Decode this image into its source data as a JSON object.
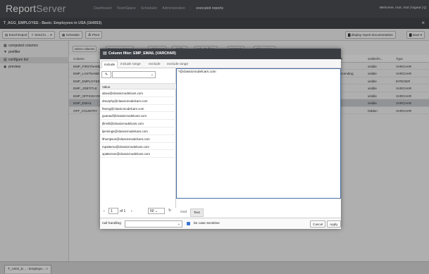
{
  "app": {
    "logo_main": "Report",
    "logo_rest": "Server",
    "nav": [
      "Dashboard",
      "TeamSpace",
      "Scheduler",
      "Administration"
    ],
    "nav_sep": "|",
    "nav_current": "executed reports",
    "user_text": "Welcome, root, root | logout | Q"
  },
  "report": {
    "title": "T_AGG_EMPLOYEE - Basic: Employees in USA (164553)",
    "close_icon": "×"
  },
  "toolbar": {
    "export": "Excel-Export ▾",
    "send_to": "Send to ... ▾",
    "schedule": "Schedule",
    "pivot": "Pivot",
    "display_doc": "display report documentation",
    "save": "save ▾"
  },
  "sidebar": {
    "items": [
      {
        "label": "computed columns",
        "icon": "computed-icon"
      },
      {
        "label": "prefilter",
        "icon": "filter-icon"
      },
      {
        "label": "configure list",
        "icon": "list-icon"
      },
      {
        "label": "preview",
        "icon": "eye-icon"
      }
    ]
  },
  "subtoolbar": {
    "select_columns": "select columns",
    "remove_column": "Remove column ▾",
    "edit_format": "edit format",
    "edit_filter": "edit filter",
    "defaults": "defaults filters",
    "subtotals": "Subtotals",
    "edit_template": "Edit template"
  },
  "grid": {
    "headers": [
      "Column",
      "",
      "Sort",
      "visible/hi...",
      "Type"
    ],
    "rows": [
      {
        "column": "EMP_FIRSTNAME",
        "sort": "",
        "visible": "visible",
        "type": "VARCHAR"
      },
      {
        "column": "EMP_LASTNAME",
        "sort": "descending",
        "visible": "visible",
        "type": "VARCHAR"
      },
      {
        "column": "EMP_EMPLOYEENUMBER",
        "sort": "",
        "visible": "visible",
        "type": "INTEGER"
      },
      {
        "column": "EMP_JOBTITLE",
        "sort": "",
        "visible": "visible",
        "type": "VARCHAR"
      },
      {
        "column": "EMP_OFFICECODE",
        "sort": "",
        "visible": "visible",
        "type": "VARCHAR"
      },
      {
        "column": "EMP_EMAIL",
        "sort": "",
        "visible": "visible",
        "type": "VARCHAR"
      },
      {
        "column": "OFF_COUNTRY",
        "sort": "",
        "visible": "hidden",
        "type": "VARCHAR"
      }
    ]
  },
  "bottom_tab": {
    "label": "T_AGG_E... : Employe...",
    "close": "×"
  },
  "dialog": {
    "title": "Column filter: EMP_EMAIL (VARCHAR)",
    "tabs": [
      "include",
      "include range",
      "exclude",
      "exclude range"
    ],
    "active_tab": "include",
    "value_header": "Value",
    "values": [
      "abow@classicmodelcars.com",
      "dmurphy@classicmodelcars.com",
      "ftseng@classicmodelcars.com",
      "gvanauf@classicmodelcars.com",
      "jfirrelli@classicmodelcars.com",
      "ljennings@classicmodelcars.com",
      "lthompson@classicmodelcars.com",
      "mpatterso@classicmodelcars.com",
      "spatterson@classicmodelcars.com"
    ],
    "filter_text": "*@classicmodelcars.com",
    "pager": {
      "page": "1",
      "of_pages": "of 1",
      "page_size": "50"
    },
    "grid_tab": "Grid",
    "text_tab": "Text",
    "null_handling_label": "null handling",
    "case_sensitive_label": "be case sensitive",
    "cancel": "Cancel",
    "apply": "Apply"
  }
}
